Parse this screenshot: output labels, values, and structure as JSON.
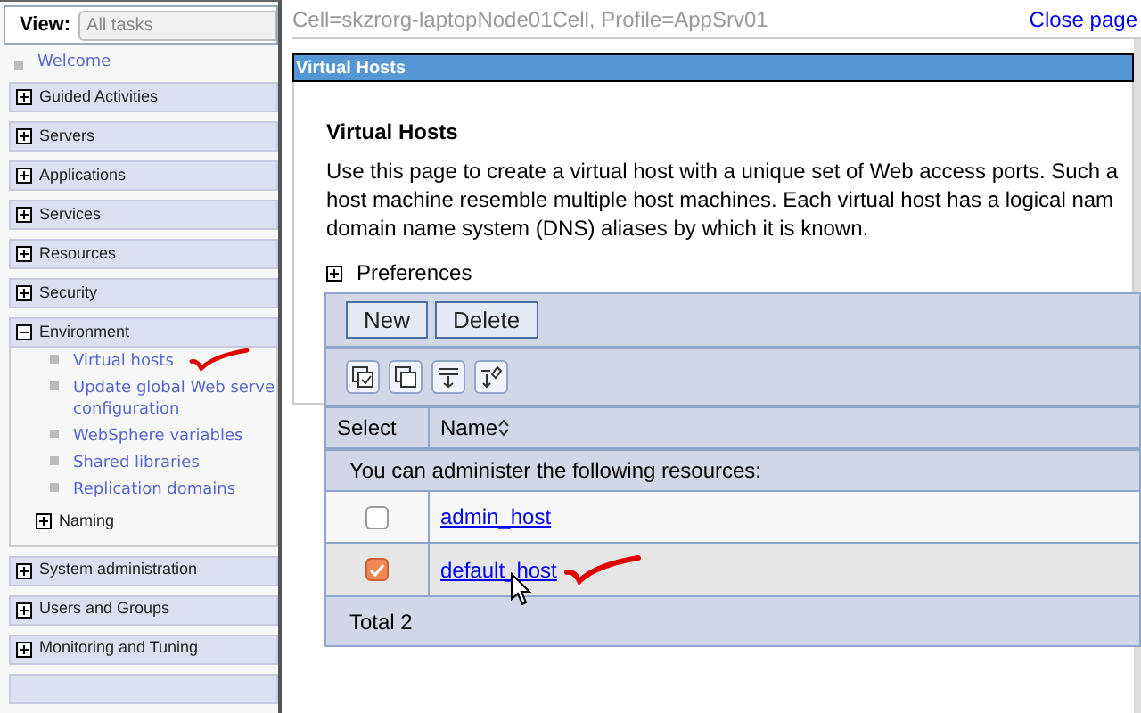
{
  "sidebar": {
    "view_label": "View:",
    "view_value": "All tasks",
    "welcome": "Welcome",
    "categories": [
      {
        "label": "Guided Activities",
        "expanded": false
      },
      {
        "label": "Servers",
        "expanded": false
      },
      {
        "label": "Applications",
        "expanded": false
      },
      {
        "label": "Services",
        "expanded": false
      },
      {
        "label": "Resources",
        "expanded": false
      },
      {
        "label": "Security",
        "expanded": false
      },
      {
        "label": "Environment",
        "expanded": true,
        "children": [
          {
            "kind": "link",
            "label": "Virtual hosts",
            "annotated": true
          },
          {
            "kind": "link",
            "label": "Update global Web serve configuration",
            "annotated": false
          },
          {
            "kind": "link",
            "label": "WebSphere variables",
            "annotated": false
          },
          {
            "kind": "link",
            "label": "Shared libraries",
            "annotated": false
          },
          {
            "kind": "link",
            "label": "Replication domains",
            "annotated": false
          },
          {
            "kind": "group",
            "label": "Naming",
            "expanded": false
          }
        ]
      },
      {
        "label": "System administration",
        "expanded": false
      },
      {
        "label": "Users and Groups",
        "expanded": false
      },
      {
        "label": "Monitoring and Tuning",
        "expanded": false
      }
    ]
  },
  "header": {
    "context": "Cell=skzrorg-laptopNode01Cell, Profile=AppSrv01",
    "close_link": "Close page"
  },
  "panel": {
    "title": "Virtual Hosts",
    "heading": "Virtual Hosts",
    "description": [
      "Use this page to create a virtual host with a unique set of Web access ports. Such a",
      "host machine resemble multiple host machines. Each virtual host has a logical nam",
      "domain name system (DNS) aliases by which it is known."
    ],
    "preferences": {
      "label": "Preferences",
      "expanded": false
    },
    "buttons": [
      "New",
      "Delete"
    ],
    "columns": [
      "Select",
      "Name"
    ],
    "info": "You can administer the following resources:",
    "rows": [
      {
        "name": "admin_host",
        "selected": false,
        "annotated": false
      },
      {
        "name": "default_host",
        "selected": true,
        "annotated": true
      }
    ],
    "total": "Total 2"
  }
}
